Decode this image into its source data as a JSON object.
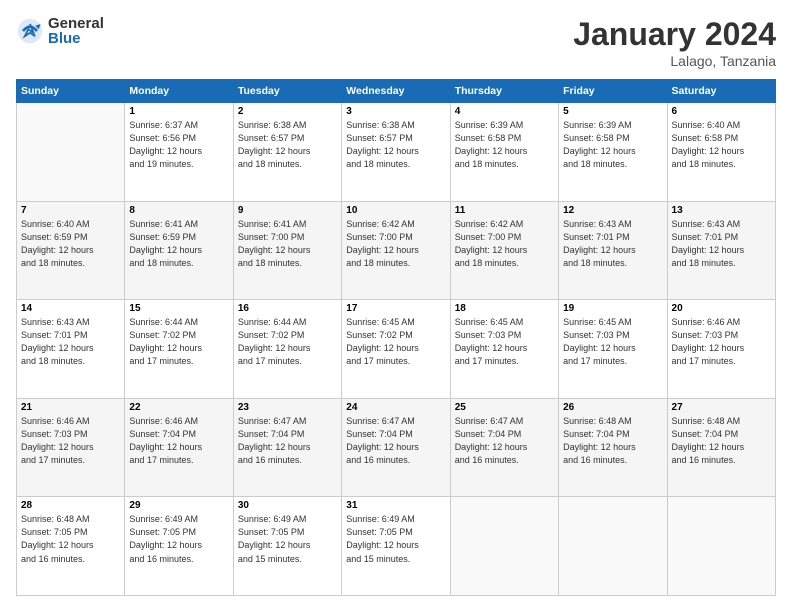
{
  "logo": {
    "general": "General",
    "blue": "Blue"
  },
  "title": "January 2024",
  "location": "Lalago, Tanzania",
  "weekdays": [
    "Sunday",
    "Monday",
    "Tuesday",
    "Wednesday",
    "Thursday",
    "Friday",
    "Saturday"
  ],
  "weeks": [
    [
      {
        "day": "",
        "detail": ""
      },
      {
        "day": "1",
        "detail": "Sunrise: 6:37 AM\nSunset: 6:56 PM\nDaylight: 12 hours\nand 19 minutes."
      },
      {
        "day": "2",
        "detail": "Sunrise: 6:38 AM\nSunset: 6:57 PM\nDaylight: 12 hours\nand 18 minutes."
      },
      {
        "day": "3",
        "detail": "Sunrise: 6:38 AM\nSunset: 6:57 PM\nDaylight: 12 hours\nand 18 minutes."
      },
      {
        "day": "4",
        "detail": "Sunrise: 6:39 AM\nSunset: 6:58 PM\nDaylight: 12 hours\nand 18 minutes."
      },
      {
        "day": "5",
        "detail": "Sunrise: 6:39 AM\nSunset: 6:58 PM\nDaylight: 12 hours\nand 18 minutes."
      },
      {
        "day": "6",
        "detail": "Sunrise: 6:40 AM\nSunset: 6:58 PM\nDaylight: 12 hours\nand 18 minutes."
      }
    ],
    [
      {
        "day": "7",
        "detail": "Sunrise: 6:40 AM\nSunset: 6:59 PM\nDaylight: 12 hours\nand 18 minutes."
      },
      {
        "day": "8",
        "detail": "Sunrise: 6:41 AM\nSunset: 6:59 PM\nDaylight: 12 hours\nand 18 minutes."
      },
      {
        "day": "9",
        "detail": "Sunrise: 6:41 AM\nSunset: 7:00 PM\nDaylight: 12 hours\nand 18 minutes."
      },
      {
        "day": "10",
        "detail": "Sunrise: 6:42 AM\nSunset: 7:00 PM\nDaylight: 12 hours\nand 18 minutes."
      },
      {
        "day": "11",
        "detail": "Sunrise: 6:42 AM\nSunset: 7:00 PM\nDaylight: 12 hours\nand 18 minutes."
      },
      {
        "day": "12",
        "detail": "Sunrise: 6:43 AM\nSunset: 7:01 PM\nDaylight: 12 hours\nand 18 minutes."
      },
      {
        "day": "13",
        "detail": "Sunrise: 6:43 AM\nSunset: 7:01 PM\nDaylight: 12 hours\nand 18 minutes."
      }
    ],
    [
      {
        "day": "14",
        "detail": "Sunrise: 6:43 AM\nSunset: 7:01 PM\nDaylight: 12 hours\nand 18 minutes."
      },
      {
        "day": "15",
        "detail": "Sunrise: 6:44 AM\nSunset: 7:02 PM\nDaylight: 12 hours\nand 17 minutes."
      },
      {
        "day": "16",
        "detail": "Sunrise: 6:44 AM\nSunset: 7:02 PM\nDaylight: 12 hours\nand 17 minutes."
      },
      {
        "day": "17",
        "detail": "Sunrise: 6:45 AM\nSunset: 7:02 PM\nDaylight: 12 hours\nand 17 minutes."
      },
      {
        "day": "18",
        "detail": "Sunrise: 6:45 AM\nSunset: 7:03 PM\nDaylight: 12 hours\nand 17 minutes."
      },
      {
        "day": "19",
        "detail": "Sunrise: 6:45 AM\nSunset: 7:03 PM\nDaylight: 12 hours\nand 17 minutes."
      },
      {
        "day": "20",
        "detail": "Sunrise: 6:46 AM\nSunset: 7:03 PM\nDaylight: 12 hours\nand 17 minutes."
      }
    ],
    [
      {
        "day": "21",
        "detail": "Sunrise: 6:46 AM\nSunset: 7:03 PM\nDaylight: 12 hours\nand 17 minutes."
      },
      {
        "day": "22",
        "detail": "Sunrise: 6:46 AM\nSunset: 7:04 PM\nDaylight: 12 hours\nand 17 minutes."
      },
      {
        "day": "23",
        "detail": "Sunrise: 6:47 AM\nSunset: 7:04 PM\nDaylight: 12 hours\nand 16 minutes."
      },
      {
        "day": "24",
        "detail": "Sunrise: 6:47 AM\nSunset: 7:04 PM\nDaylight: 12 hours\nand 16 minutes."
      },
      {
        "day": "25",
        "detail": "Sunrise: 6:47 AM\nSunset: 7:04 PM\nDaylight: 12 hours\nand 16 minutes."
      },
      {
        "day": "26",
        "detail": "Sunrise: 6:48 AM\nSunset: 7:04 PM\nDaylight: 12 hours\nand 16 minutes."
      },
      {
        "day": "27",
        "detail": "Sunrise: 6:48 AM\nSunset: 7:04 PM\nDaylight: 12 hours\nand 16 minutes."
      }
    ],
    [
      {
        "day": "28",
        "detail": "Sunrise: 6:48 AM\nSunset: 7:05 PM\nDaylight: 12 hours\nand 16 minutes."
      },
      {
        "day": "29",
        "detail": "Sunrise: 6:49 AM\nSunset: 7:05 PM\nDaylight: 12 hours\nand 16 minutes."
      },
      {
        "day": "30",
        "detail": "Sunrise: 6:49 AM\nSunset: 7:05 PM\nDaylight: 12 hours\nand 15 minutes."
      },
      {
        "day": "31",
        "detail": "Sunrise: 6:49 AM\nSunset: 7:05 PM\nDaylight: 12 hours\nand 15 minutes."
      },
      {
        "day": "",
        "detail": ""
      },
      {
        "day": "",
        "detail": ""
      },
      {
        "day": "",
        "detail": ""
      }
    ]
  ]
}
